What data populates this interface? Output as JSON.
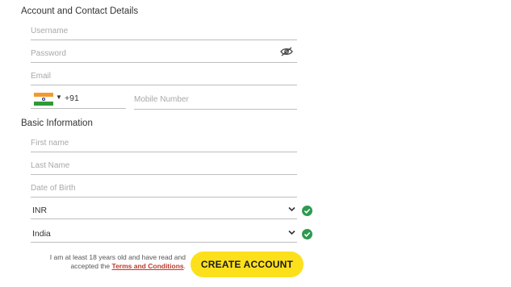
{
  "sections": {
    "account_title": "Account and Contact Details",
    "basic_title": "Basic Information"
  },
  "account": {
    "username_placeholder": "Username",
    "password_placeholder": "Password",
    "email_placeholder": "Email",
    "dial_code": "+91",
    "mobile_placeholder": "Mobile Number",
    "country_flag": "india-flag-icon"
  },
  "basic": {
    "first_name_placeholder": "First name",
    "last_name_placeholder": "Last Name",
    "dob_placeholder": "Date of Birth",
    "currency_value": "INR",
    "country_value": "India"
  },
  "footer": {
    "terms_prefix": "I am at least 18 years old and have read and accepted the",
    "terms_link": "Terms and Conditions",
    "terms_suffix": ".",
    "create_button": "CREATE ACCOUNT"
  },
  "colors": {
    "button_bg": "#fde01c",
    "valid_check": "#2e9a4f",
    "link": "#c0392b"
  }
}
